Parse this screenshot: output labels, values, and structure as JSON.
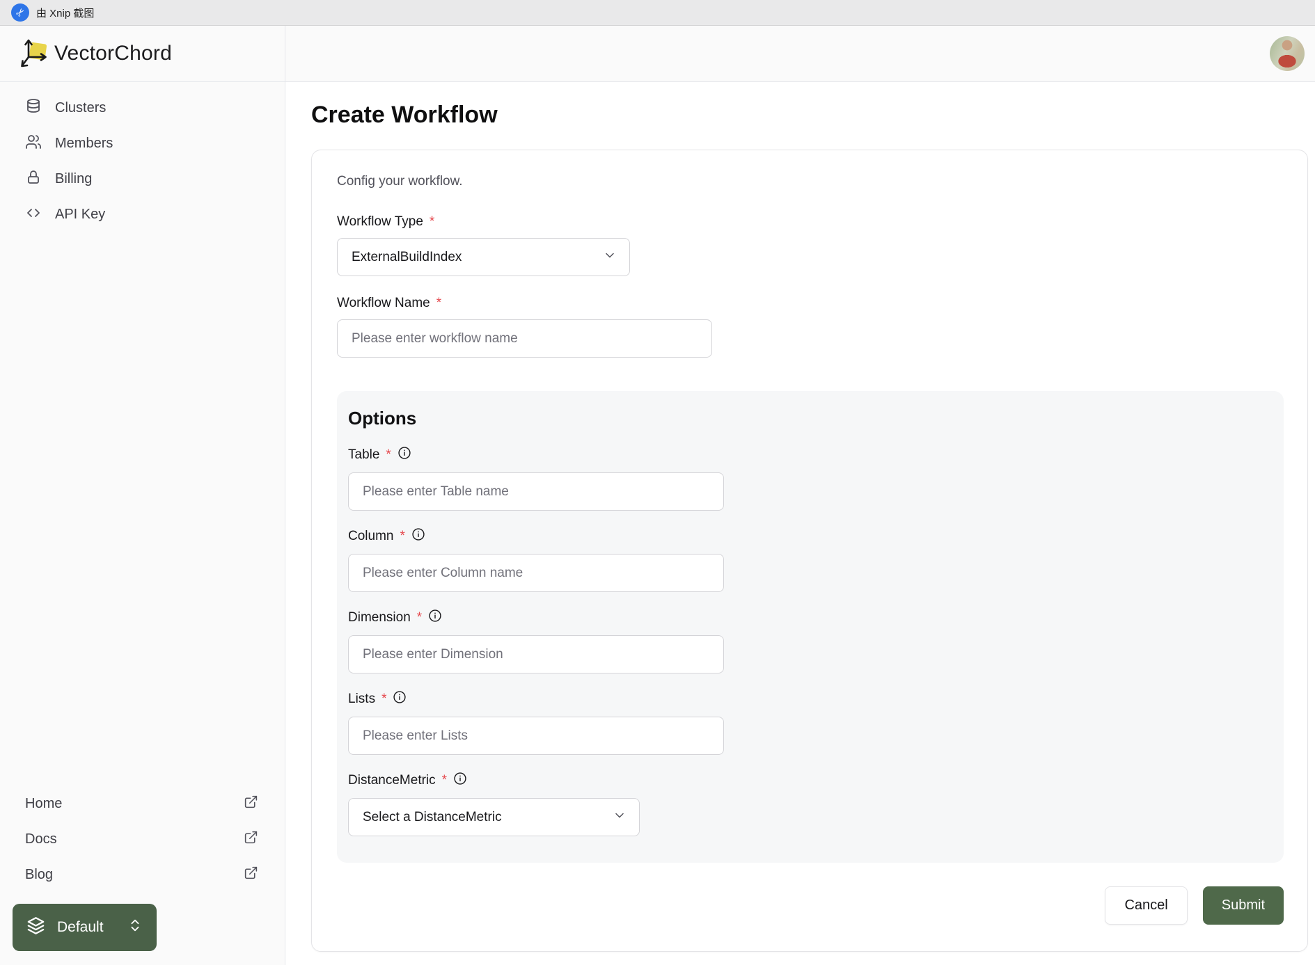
{
  "topbar": {
    "label": "由 Xnip 截图",
    "icon": "xnip-scissors-icon",
    "icon_color": "#2e75e8"
  },
  "brand": {
    "name": "VectorChord",
    "logo_color": "#e8d44a"
  },
  "sidebar": {
    "items": [
      {
        "label": "Clusters",
        "icon": "database-icon"
      },
      {
        "label": "Members",
        "icon": "users-icon"
      },
      {
        "label": "Billing",
        "icon": "lock-icon"
      },
      {
        "label": "API Key",
        "icon": "code-icon"
      }
    ],
    "links": [
      {
        "label": "Home",
        "icon": "external-link-icon"
      },
      {
        "label": "Docs",
        "icon": "external-link-icon"
      },
      {
        "label": "Blog",
        "icon": "external-link-icon"
      }
    ],
    "project_switcher": {
      "label": "Default",
      "icon": "layers-icon",
      "chevrons": "chevrons-up-down-icon"
    }
  },
  "main": {
    "title": "Create Workflow",
    "card": {
      "description": "Config your workflow.",
      "required_mark": "*",
      "workflow_type": {
        "label": "Workflow Type",
        "value": "ExternalBuildIndex"
      },
      "workflow_name": {
        "label": "Workflow Name",
        "placeholder": "Please enter workflow name"
      },
      "options": {
        "heading": "Options",
        "fields": [
          {
            "label": "Table",
            "placeholder": "Please enter Table name",
            "control": "input"
          },
          {
            "label": "Column",
            "placeholder": "Please enter Column name",
            "control": "input"
          },
          {
            "label": "Dimension",
            "placeholder": "Please enter Dimension",
            "control": "input"
          },
          {
            "label": "Lists",
            "placeholder": "Please enter Lists",
            "control": "input"
          },
          {
            "label": "DistanceMetric",
            "placeholder": "Select a DistanceMetric",
            "control": "select"
          }
        ]
      },
      "actions": {
        "cancel": "Cancel",
        "submit": "Submit"
      }
    }
  },
  "colors": {
    "submit_green": "#4f694a",
    "switcher_green": "#4a6148",
    "required_red": "#e5484d",
    "panel_gray": "#f6f7f8"
  }
}
